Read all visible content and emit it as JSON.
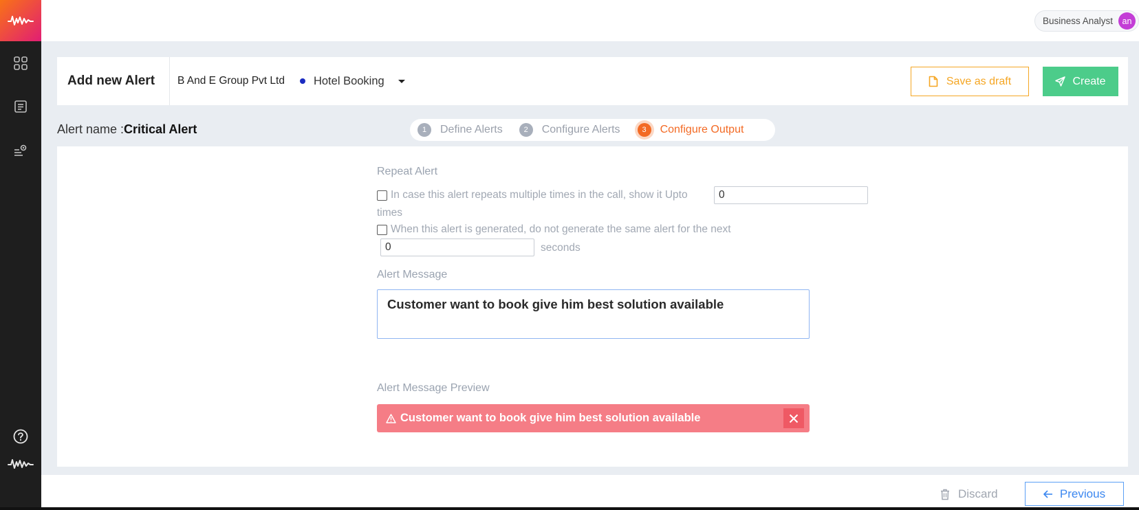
{
  "sidebar": {
    "logo_icon": "waveform-logo-icon",
    "nav_items": [
      "dashboard-grid-icon",
      "document-list-icon",
      "settings-list-icon"
    ],
    "help_icon": "help-circle-icon",
    "bottom_logo_icon": "waveform-logo-icon",
    "gradient_colors": [
      "#f97316",
      "#e11d74"
    ]
  },
  "topbar": {
    "user_role": "Business Analyst",
    "avatar_initials": "an"
  },
  "header": {
    "title": "Add new Alert",
    "company": "B And E Group Pvt Ltd",
    "project": "Hotel Booking",
    "save_draft_label": "Save as draft",
    "create_label": "Create"
  },
  "alert": {
    "name_label": "Alert name :",
    "name_value": "Critical Alert"
  },
  "steps": [
    {
      "num": "1",
      "label": "Define Alerts",
      "active": false
    },
    {
      "num": "2",
      "label": "Configure Alerts",
      "active": false
    },
    {
      "num": "3",
      "label": "Configure Output",
      "active": true
    }
  ],
  "form": {
    "repeat_alert_label": "Repeat Alert",
    "repeat_option_text": "In case this alert repeats multiple times in the call, show it Upto",
    "repeat_option_value": "0",
    "repeat_option_suffix": "times",
    "suppress_option_text": "When this alert is generated, do not generate the same alert for the next",
    "suppress_option_value": "0",
    "suppress_option_suffix": "seconds",
    "message_label": "Alert Message",
    "message_value": "Customer want to book give him best solution available",
    "preview_label": "Alert Message Preview",
    "preview_text": "Customer want to book give him best solution available"
  },
  "footer": {
    "discard_label": "Discard",
    "previous_label": "Previous"
  },
  "colors": {
    "accent_orange": "#f5a623",
    "create_green": "#4ccc8a",
    "step_active": "#f36a24",
    "preview_bg": "#f57d86",
    "previous_blue": "#3b87f0"
  }
}
